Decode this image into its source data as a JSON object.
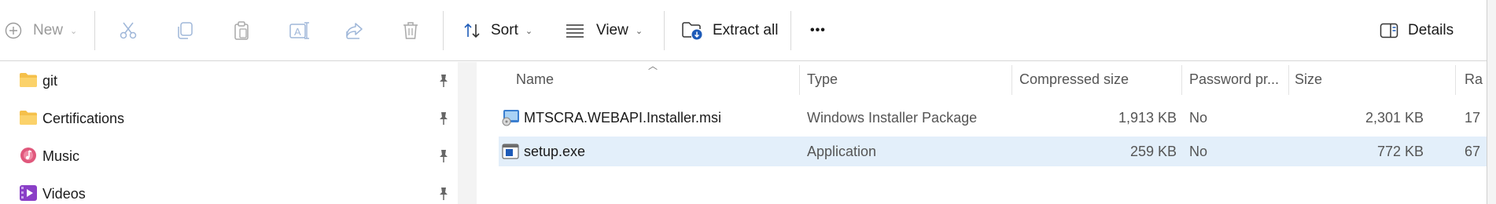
{
  "toolbar": {
    "new_label": "New",
    "sort_label": "Sort",
    "view_label": "View",
    "extract_all_label": "Extract all",
    "more_label": "•••",
    "details_label": "Details"
  },
  "nav": {
    "items": [
      {
        "label": "git",
        "icon": "folder-icon"
      },
      {
        "label": "Certifications",
        "icon": "folder-icon"
      },
      {
        "label": "Music",
        "icon": "music-icon"
      },
      {
        "label": "Videos",
        "icon": "videos-icon"
      }
    ]
  },
  "columns": {
    "name": "Name",
    "type": "Type",
    "compressed_size": "Compressed size",
    "password": "Password pr...",
    "size": "Size",
    "ratio": "Ra"
  },
  "files": [
    {
      "name": "MTSCRA.WEBAPI.Installer.msi",
      "type": "Windows Installer Package",
      "compressed_size": "1,913 KB",
      "password": "No",
      "size": "2,301 KB",
      "ratio": "17",
      "icon": "msi-installer-icon",
      "selected": false
    },
    {
      "name": "setup.exe",
      "type": "Application",
      "compressed_size": "259 KB",
      "password": "No",
      "size": "772 KB",
      "ratio": "67",
      "icon": "exe-application-icon",
      "selected": true
    }
  ],
  "colors": {
    "selection": "#e3effa",
    "accent": "#1e5bb8",
    "folder": "#f5c04a"
  }
}
